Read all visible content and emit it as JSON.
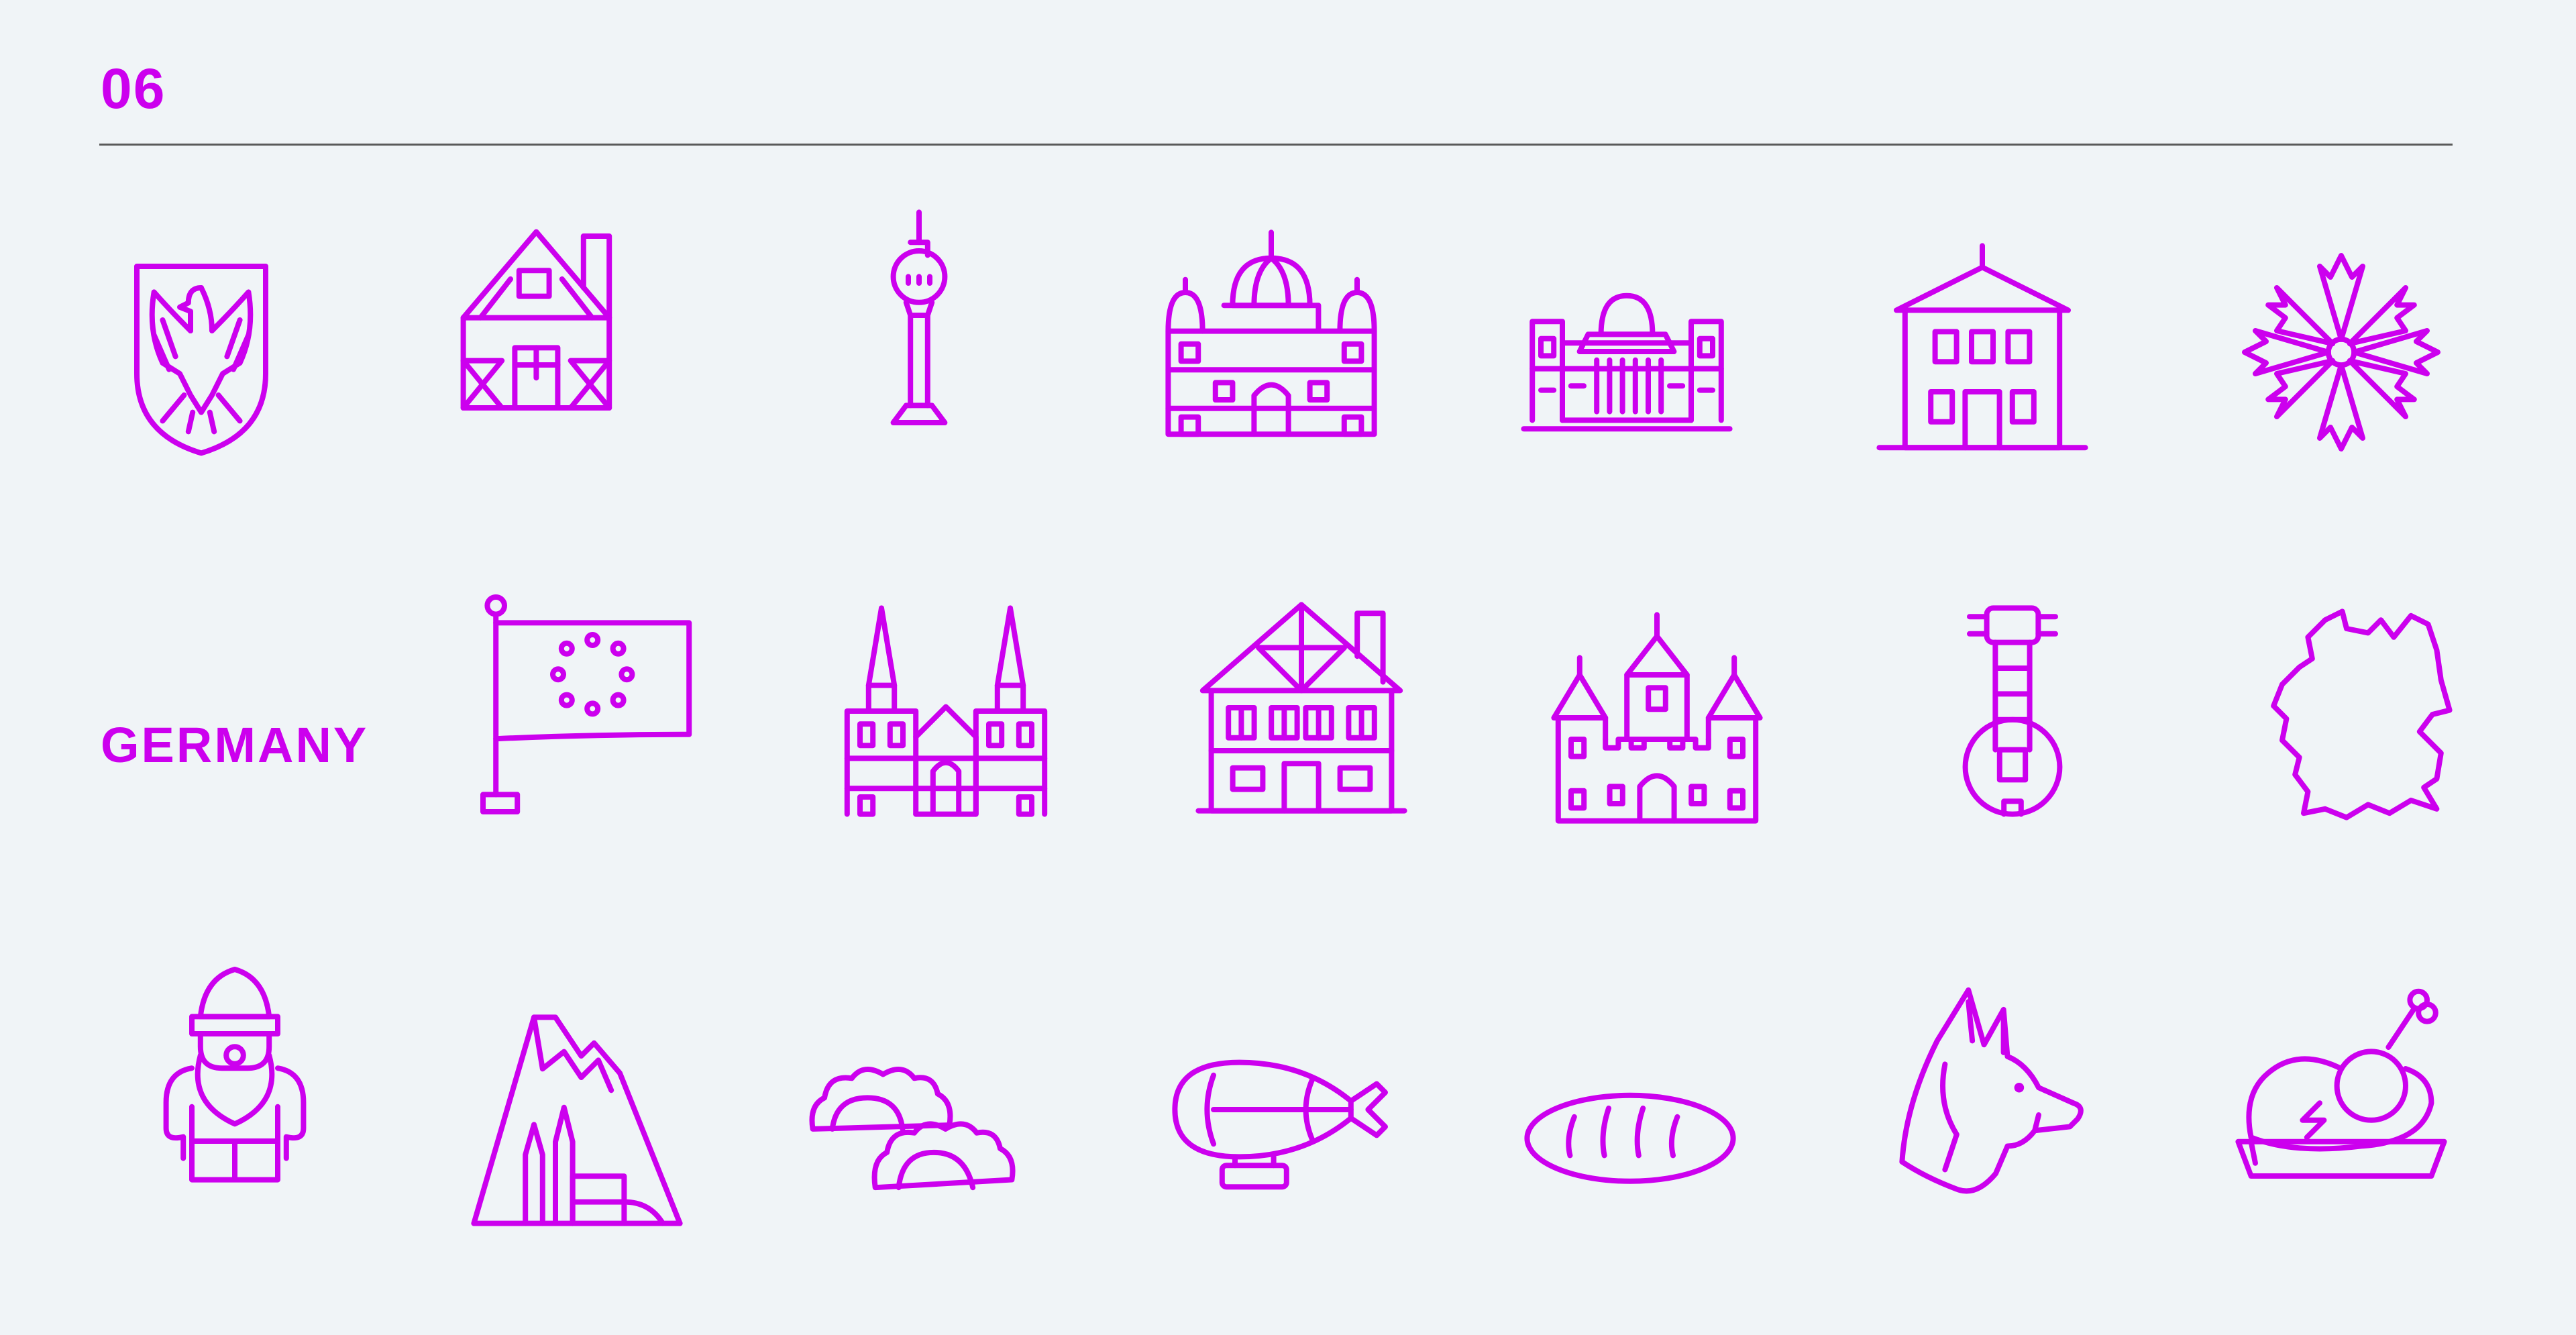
{
  "header": {
    "number": "06"
  },
  "set_label": "GERMANY",
  "colors": {
    "accent": "#cc00ee",
    "background": "#f0f4f7",
    "rule": "#5a5a5a"
  },
  "icons": [
    "eagle-coat-of-arms-icon",
    "half-timbered-house-icon",
    "tv-tower-icon",
    "cathedral-dome-icon",
    "reichstag-icon",
    "town-hall-icon",
    "cornflower-icon",
    "eu-flag-icon",
    "cologne-cathedral-icon",
    "timber-frame-house-icon",
    "castle-icon",
    "banjo-icon",
    "germany-map-icon",
    "garden-gnome-icon",
    "mountain-castle-icon",
    "dumplings-icon",
    "zeppelin-icon",
    "bread-loaf-icon",
    "shepherd-dog-icon",
    "roast-chicken-icon"
  ]
}
